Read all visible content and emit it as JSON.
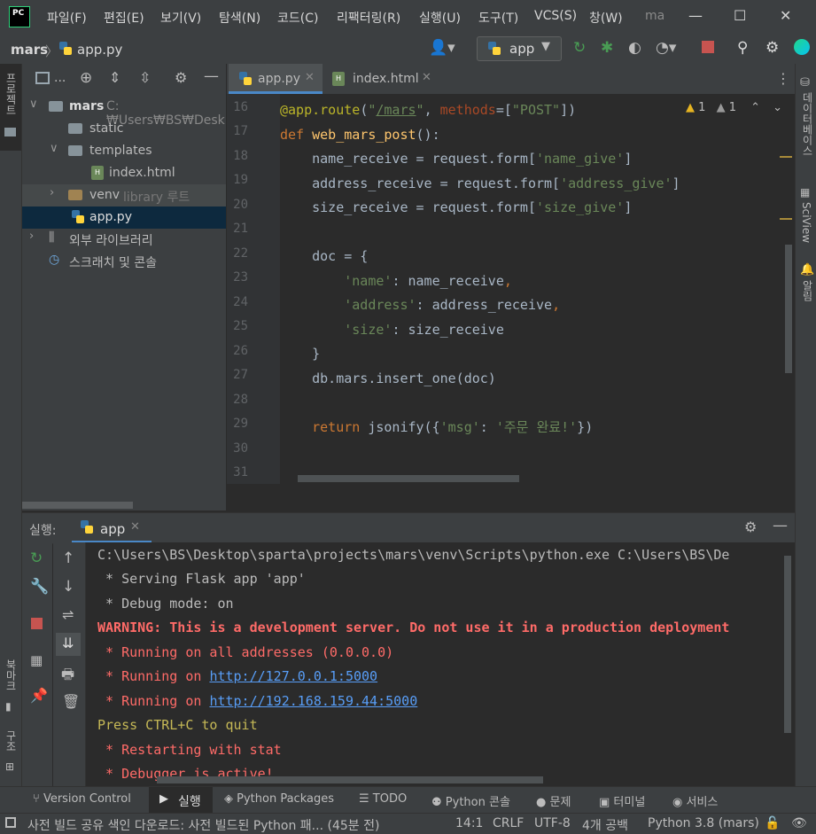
{
  "menu": {
    "items": [
      "파일(F)",
      "편집(E)",
      "보기(V)",
      "탐색(N)",
      "코드(C)",
      "리팩터링(R)",
      "실행(U)",
      "도구(T)",
      "VCS(S)",
      "창(W)"
    ],
    "title_fragment": "ma"
  },
  "nav": {
    "project": "mars",
    "file": "app.py",
    "run_config": "app"
  },
  "left_stripe": {
    "project_label": "프로젝트",
    "bookmarks_label": "북마크",
    "structure_label": "구조"
  },
  "right_stripe": {
    "database_label": "데이터베이스",
    "sciview_label": "SciView",
    "notifications_label": "알림"
  },
  "project_panel": {
    "header_title": "...",
    "tree": [
      {
        "label": "mars",
        "path": "C:₩Users₩BS₩Desk"
      },
      {
        "label": "static"
      },
      {
        "label": "templates"
      },
      {
        "label": "index.html"
      },
      {
        "label": "venv",
        "tag": "library 루트"
      },
      {
        "label": "app.py"
      },
      {
        "label": "외부 라이브러리"
      },
      {
        "label": "스크래치 및 콘솔"
      }
    ]
  },
  "editor": {
    "tabs": [
      {
        "label": "app.py",
        "active": true
      },
      {
        "label": "index.html",
        "active": false
      }
    ],
    "inspection": {
      "warn1": "1",
      "warn2": "1"
    },
    "line_numbers": [
      "16",
      "17",
      "18",
      "19",
      "20",
      "21",
      "22",
      "23",
      "24",
      "25",
      "26",
      "27",
      "28",
      "29",
      "30",
      "31"
    ]
  },
  "run": {
    "label": "실행:",
    "tab": "app",
    "console": [
      "C:\\Users\\BS\\Desktop\\sparta\\projects\\mars\\venv\\Scripts\\python.exe C:\\Users\\BS\\De",
      " * Serving Flask app 'app'",
      " * Debug mode: on",
      "WARNING: This is a development server. Do not use it in a production deployment",
      " * Running on all addresses (0.0.0.0)",
      " * Running on ",
      "http://127.0.0.1:5000",
      " * Running on ",
      "http://192.168.159.44:5000",
      "Press CTRL+C to quit",
      " * Restarting with stat",
      " * Debugger is active!"
    ]
  },
  "bottom_tabs": [
    "Version Control",
    "실행",
    "Python Packages",
    "TODO",
    "Python 콘솔",
    "문제",
    "터미널",
    "서비스"
  ],
  "status": {
    "message": "사전 빌드 공유 색인 다운로드: 사전 빌드된 Python 패... (45분 전)",
    "position": "14:1",
    "line_sep": "CRLF",
    "encoding": "UTF-8",
    "indent": "4개 공백",
    "interpreter": "Python 3.8 (mars)"
  },
  "colors": {
    "accent": "#4a88c7",
    "run_green": "#499c54",
    "stop_red": "#c75450",
    "warning_red": "#ff6b68",
    "link_blue": "#589df6",
    "quit_yellow": "#c6b956"
  }
}
